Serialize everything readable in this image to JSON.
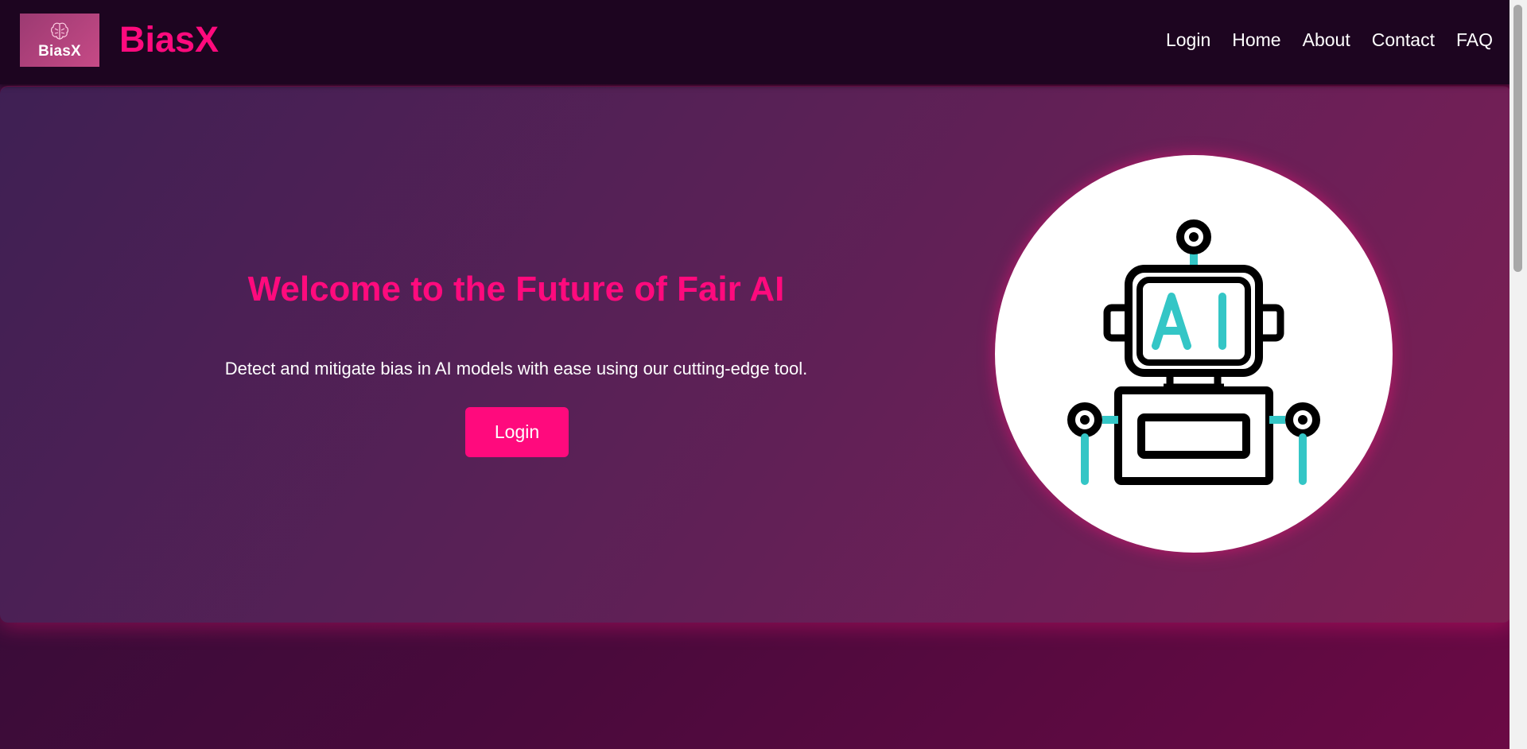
{
  "brand": {
    "logo_text": "BiasX",
    "name": "BiasX"
  },
  "nav": {
    "items": [
      {
        "label": "Login"
      },
      {
        "label": "Home"
      },
      {
        "label": "About"
      },
      {
        "label": "Contact"
      },
      {
        "label": "FAQ"
      }
    ]
  },
  "hero": {
    "title": "Welcome to the Future of Fair AI",
    "subtitle": "Detect and mitigate bias in AI models with ease using our cutting-edge tool.",
    "login_label": "Login",
    "illustration": {
      "icon": "robot-icon",
      "badge_text": "AI"
    }
  },
  "colors": {
    "accent": "#ff0a7d",
    "navbar_bg": "#1d0520",
    "robot_teal": "#34c6c6"
  }
}
